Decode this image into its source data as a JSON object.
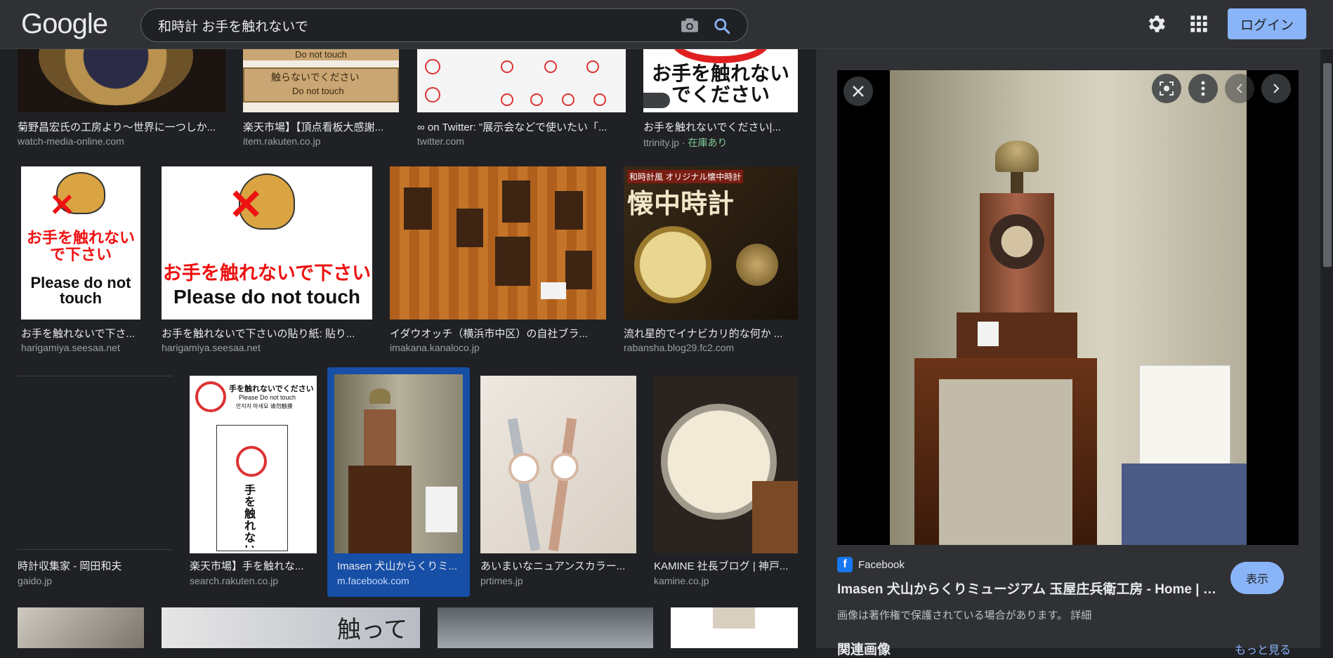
{
  "header": {
    "logo": "Google",
    "search_value": "和時計 お手を触れないで",
    "login_label": "ログイン"
  },
  "results": [
    {
      "title": "菊野昌宏氏の工房より〜世界に一つしか...",
      "source": "watch-media-online.com"
    },
    {
      "title": "楽天市場】【頂点看板大感謝...",
      "source": "item.rakuten.co.jp"
    },
    {
      "title": "∞ on Twitter: \"展示会などで使いたい「...",
      "source": "twitter.com"
    },
    {
      "title": "お手を触れないでください|...",
      "source": "ttrinity.jp",
      "stock": "在庫あり"
    },
    {
      "title": "お手を触れないで下さ...",
      "source": "harigamiya.seesaa.net"
    },
    {
      "title": "お手を触れないで下さいの貼り紙: 貼り...",
      "source": "harigamiya.seesaa.net"
    },
    {
      "title": "イダウオッチ（横浜市中区）の自社ブラ...",
      "source": "imakana.kanaloco.jp"
    },
    {
      "title": "流れ星的でイナビカリ的な何か ...",
      "source": "rabansha.blog29.fc2.com"
    },
    {
      "title": "時計収集家 - 岡田和夫",
      "source": "gaido.jp"
    },
    {
      "title": "楽天市場】手を触れな...",
      "source": "search.rakuten.co.jp"
    },
    {
      "title": "Imasen 犬山からくりミ...",
      "source": "m.facebook.com"
    },
    {
      "title": "あいまいなニュアンスカラー...",
      "source": "prtimes.jp"
    },
    {
      "title": "KAMINE 社長ブログ | 神戸...",
      "source": "kamine.co.jp"
    }
  ],
  "image_text": {
    "do_not_touch": "Do not touch",
    "sign_jp": "触らないでください",
    "please_do_not_touch": "Please do not touch",
    "otewo": "お手を触れないでください",
    "cat_jp": "お手を触れないで下さい",
    "cat_en": "Please do not touch",
    "cat_small_jp": "お手を触れないで下さい",
    "cat_small_en": "Please do not touch",
    "pocket_brand": "和時計風 オリジナル懐中時計",
    "pocket_title": "懐中時計",
    "sign2_top": "手を触れないでください",
    "sign2_en": "Please Do not touch",
    "sign2_kr": "만지지 마세요 请勿触摸",
    "sign2_vert": "手を触れないでください",
    "touch_jp": "触って"
  },
  "panel": {
    "source_name": "Facebook",
    "title": "Imasen 犬山からくりミュージアム 玉屋庄兵衛工房 - Home | Face...",
    "view_label": "表示",
    "copyright": "画像は著作権で保護されている場合があります。 詳細",
    "related": "関連画像",
    "more": "もっと見る"
  },
  "colors": {
    "background": "#202124",
    "topbar": "#303134",
    "accent": "#8ab4f8",
    "selection": "#174ea6",
    "stock": "#81c995"
  }
}
